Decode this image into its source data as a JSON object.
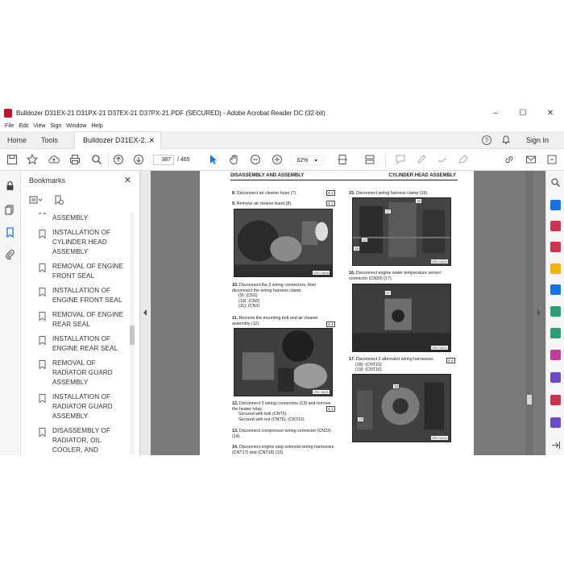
{
  "window": {
    "title": "Bulldozer D31EX-21 D31PX-21 D37EX-21 D37PX-21.PDF (SECURED) - Adobe Acrobat Reader DC (32-bit)",
    "minimize": "–",
    "maximize": "☐",
    "close": "✕"
  },
  "menu": [
    "File",
    "Edit",
    "View",
    "Sign",
    "Window",
    "Help"
  ],
  "tabs": {
    "home": "Home",
    "tools": "Tools",
    "document": "Bulldozer D31EX-2...",
    "document_close": "✕",
    "help_icon": "?",
    "sign_in": "Sign In"
  },
  "toolbar": {
    "page_current": "387",
    "page_total": "/ 465",
    "zoom": "62%"
  },
  "bookmarks": {
    "title": "Bookmarks",
    "close": "✕",
    "items": [
      "CYLINDER HEAD ASSEMBLY",
      "INSTALLATION OF CYLINDER HEAD ASSEMBLY",
      "REMOVAL OF ENGINE FRONT SEAL",
      "INSTALLATION OF ENGINE FRONT SEAL",
      "REMOVAL OF ENGINE REAR SEAL",
      "INSTALLATION OF ENGINE REAR SEAL",
      "REMOVAL OF RADIATOR GUARD ASSEMBLY",
      "INSTALLATION OF RADIATOR GUARD ASSEMBLY",
      "DISASSEMBLY OF RADIATOR, OIL COOLER, AND"
    ]
  },
  "document": {
    "header_left": "DISASSEMBLY AND ASSEMBLY",
    "header_right": "CYLINDER HEAD ASSEMBLY",
    "steps_left": [
      {
        "num": "8.",
        "text": "Disconnect air cleaner hose (7).",
        "tag": "4·1"
      },
      {
        "num": "9.",
        "text": "Remove air cleaner band (8).",
        "tag": "4·1"
      },
      {
        "num": "10.",
        "text": "Disconnect the 3 wiring connectors, then disconnect the wiring harness clamp.",
        "bullets": [
          "(9): (CN1)",
          "(10): (CN2)",
          "(11): (CN3)"
        ]
      },
      {
        "num": "11.",
        "text": "Remove the mounting bolt and air cleaner assembly (12).",
        "tag": "4·4"
      },
      {
        "num": "12.",
        "text": "Disconnect 3 wiring connectors (13) and remove the heater relay.",
        "tag": "4·1",
        "bullets": [
          "Secured with bolt (CNT5)",
          "Secured with nut (CNT6), (CNT12)"
        ]
      },
      {
        "num": "13.",
        "text": "Disconnect compressor wiring connector (CN23) (14)."
      },
      {
        "num": "14.",
        "text": "Disconnect engine stop solenoid wiring harnesses (CNT17) and (CNT18) (15)."
      }
    ],
    "steps_right": [
      {
        "num": "15.",
        "text": "Disconnect wiring harness clamp (16)."
      },
      {
        "num": "16.",
        "text": "Disconnect engine water temperature sensor connector (CN20) (17)."
      },
      {
        "num": "17.",
        "text": "Disconnect 2 alternator wiring harnesses.",
        "tag": "4·4",
        "bullets": [
          "(18): (CNT15)",
          "(19): (CNT16)"
        ]
      }
    ],
    "photos": {
      "p1": "CR9 OA18",
      "p2": "CR9 OA19",
      "p3": "CR9 OA20",
      "p4": "CR9 OA21",
      "p5": "CR9 OA22"
    },
    "photo_callouts": {
      "p3": [
        "16",
        "17",
        "15",
        "14"
      ],
      "p4": [
        "17"
      ],
      "p5": [
        "18",
        "19"
      ]
    }
  },
  "colors": {
    "acrobat_red": "#c8102e",
    "pdf_bg": "#7a7a7a",
    "select_blue": "#1473e6"
  }
}
